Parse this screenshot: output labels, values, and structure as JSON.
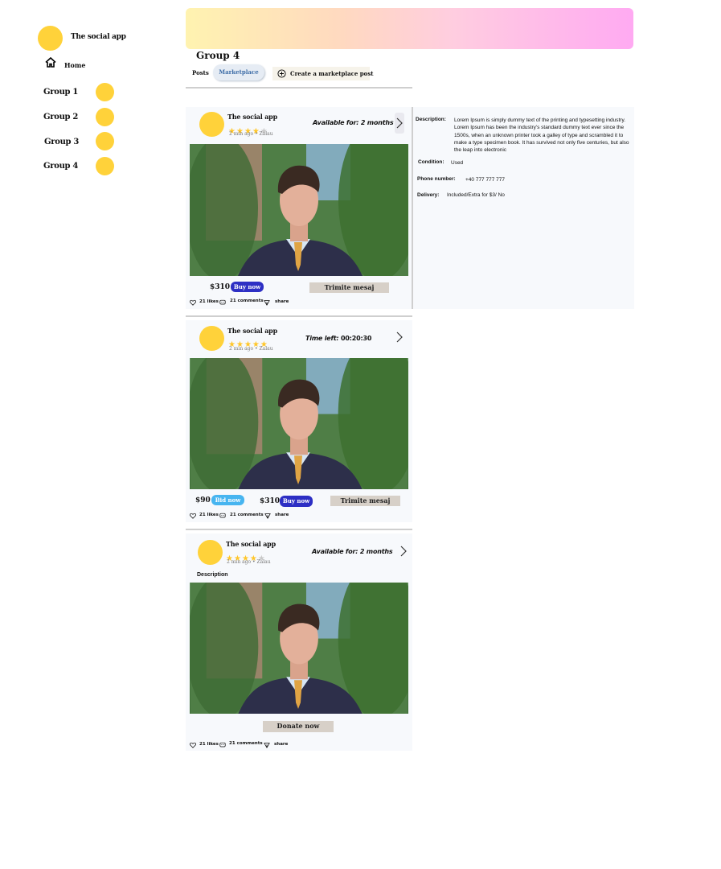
{
  "app": {
    "name": "The social app"
  },
  "nav": {
    "home": "Home"
  },
  "groups": [
    {
      "label": "Group 1"
    },
    {
      "label": "Group 2"
    },
    {
      "label": "Group 3"
    },
    {
      "label": "Group 4"
    }
  ],
  "group_header": {
    "title": "Group 4",
    "tabs": [
      "Posts",
      "Marketplace"
    ],
    "create_post": "Create a marketplace post"
  },
  "posts": [
    {
      "author": "The social app",
      "stars": 4,
      "meta": "2 min ago • Zalau",
      "availability_label": "Available for:",
      "availability_value": "2 months",
      "price": "$310",
      "buy_label": "Buy now",
      "message_label": "Trimite mesaj",
      "likes": "21 likes",
      "comments": "21 comments",
      "share": "share"
    },
    {
      "author": "The social app",
      "stars": 5,
      "meta": "2 min ago • Zalau",
      "time_left_label": "Time left:",
      "time_left_value": "00:20:30",
      "bid_price": "$90",
      "bid_label": "Bid now",
      "price": "$310",
      "buy_label": "Buy now",
      "message_label": "Trimite mesaj",
      "likes": "21 likes",
      "comments": "21 comments",
      "share": "share"
    },
    {
      "author": "The social app",
      "stars": 4,
      "meta": "2 min ago • Zalau",
      "availability_label": "Available for:",
      "availability_value": "2 months",
      "description_label": "Description",
      "donate_label": "Donate now",
      "likes": "21 likes",
      "comments": "21 comments",
      "share": "share"
    }
  ],
  "details": {
    "description_key": "Description:",
    "description_value": "Lorem Ipsum is simply dummy text of the printing and typesetting industry. Lorem Ipsum has been the industry's standard dummy text ever since the 1500s, when an unknown printer took a galley of type and scrambled it to make a type specimen book. It has survived not only five centuries, but also the leap into electronic",
    "condition_key": "Condition:",
    "condition_value": "Used",
    "phone_key": "Phone number:",
    "phone_value": "+40 777 777 777",
    "delivery_key": "Delivery:",
    "delivery_value": "Included/Extra for $3/ No"
  },
  "colors": {
    "avatar": "#ffd23a",
    "buy_button": "#2d2fc4",
    "bid_button": "#47b5f0",
    "star": "#ffc629",
    "message_button": "#d7d0c8"
  }
}
